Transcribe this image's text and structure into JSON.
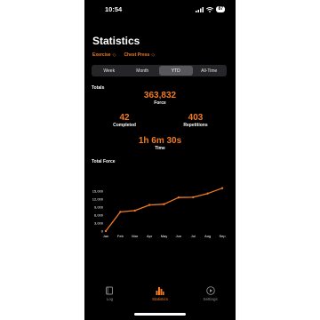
{
  "status": {
    "time": "10:54",
    "battery": "87"
  },
  "title": "Statistics",
  "filters": [
    {
      "label": "Exercise"
    },
    {
      "label": "Chest Press"
    }
  ],
  "periods": [
    "Week",
    "Month",
    "YTD",
    "All-Time"
  ],
  "selected_period": "YTD",
  "totals": {
    "label": "Totals",
    "force_value": "363,832",
    "force_label": "Force",
    "completed_value": "42",
    "completed_label": "Completed",
    "repetitions_value": "403",
    "repetitions_label": "Repetitions",
    "time_value": "1h 6m 30s",
    "time_label": "Time"
  },
  "total_force_label": "Total Force",
  "chart_data": {
    "type": "line",
    "title": "Total Force",
    "categories": [
      "Jan",
      "Feb",
      "Mar",
      "Apr",
      "May",
      "Jun",
      "Jul",
      "Aug",
      "Sep"
    ],
    "yticks": [
      "0",
      "3,000",
      "6,000",
      "9,000",
      "12,000",
      "15,000"
    ],
    "ylim": [
      0,
      18000
    ],
    "series": [
      {
        "values": [
          0,
          7200,
          7700,
          9800,
          10100,
          12600,
          12700,
          14100,
          16100
        ]
      }
    ],
    "color": "#f07a22",
    "grid": false
  },
  "tabs": [
    {
      "label": "Log",
      "icon": "log-book-icon"
    },
    {
      "label": "Statistics",
      "icon": "bar-chart-icon"
    },
    {
      "label": "Settings",
      "icon": "play-circle-icon"
    }
  ],
  "active_tab": "Statistics",
  "accent_color": "#f07a22"
}
